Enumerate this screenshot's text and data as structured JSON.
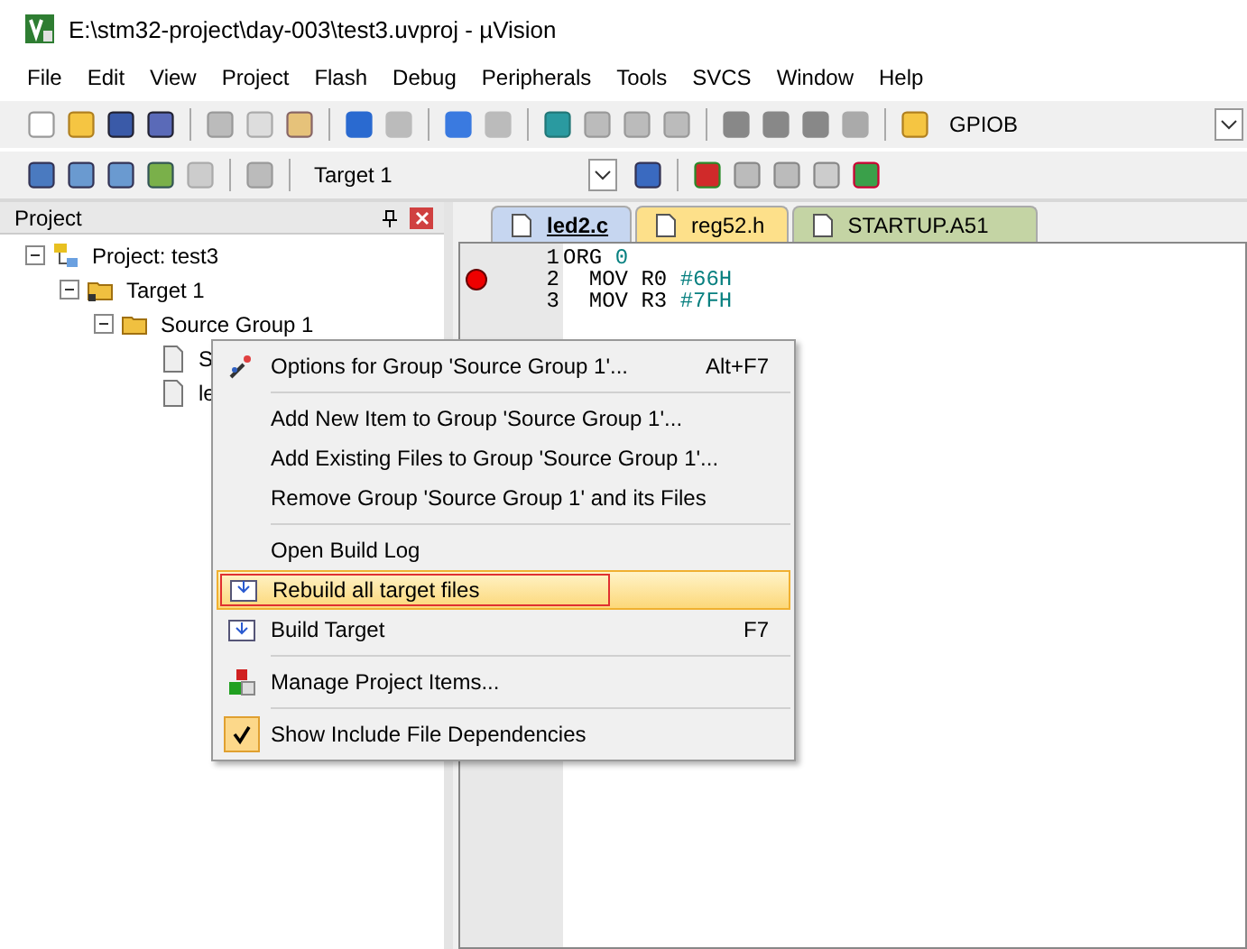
{
  "window": {
    "title": "E:\\stm32-project\\day-003\\test3.uvproj - µVision"
  },
  "menu_bar": [
    "File",
    "Edit",
    "View",
    "Project",
    "Flash",
    "Debug",
    "Peripherals",
    "Tools",
    "SVCS",
    "Window",
    "Help"
  ],
  "toolbar": {
    "function_box": "GPIOB"
  },
  "build_toolbar": {
    "target": "Target 1"
  },
  "project_panel": {
    "title": "Project",
    "tree": [
      {
        "label": "Project: test3",
        "kind": "project",
        "expanded": true,
        "children": [
          {
            "label": "Target 1",
            "kind": "target",
            "expanded": true,
            "children": [
              {
                "label": "Source Group 1",
                "kind": "group",
                "expanded": true,
                "children": [
                  {
                    "label": "S",
                    "kind": "file"
                  },
                  {
                    "label": "le",
                    "kind": "file"
                  }
                ]
              }
            ]
          }
        ]
      }
    ]
  },
  "editor": {
    "tabs": [
      {
        "label": "led2.c",
        "selected": true,
        "color": "#c6d6f0"
      },
      {
        "label": "reg52.h",
        "selected": false,
        "color": "#fde08a"
      },
      {
        "label": "STARTUP.A51",
        "selected": false,
        "color": "#c4d4a4"
      }
    ],
    "lines": [
      {
        "number": "1",
        "code": "ORG ",
        "operand": "0",
        "breakpoint": false
      },
      {
        "number": "2",
        "code": "  MOV R0 ",
        "operand": "#66H",
        "breakpoint": true
      },
      {
        "number": "3",
        "code": "  MOV R3 ",
        "operand": "#7FH",
        "breakpoint": false
      }
    ]
  },
  "context_menu": {
    "groups": [
      [
        {
          "label": "Options for Group 'Source Group 1'...",
          "shortcut": "Alt+F7",
          "selected": false,
          "checked": false
        }
      ],
      [
        {
          "label": "Add New  Item to Group 'Source Group 1'...",
          "selected": false,
          "checked": false
        },
        {
          "label": "Add Existing Files to Group 'Source Group 1'...",
          "selected": false,
          "checked": false
        },
        {
          "label": "Remove Group 'Source Group 1' and its Files",
          "selected": false,
          "checked": false
        }
      ],
      [
        {
          "label": "Open Build Log",
          "selected": false,
          "checked": false
        },
        {
          "label": "Rebuild all target files",
          "selected": true,
          "checked": false
        },
        {
          "label": "Build Target",
          "shortcut": "F7",
          "selected": false,
          "checked": false
        }
      ],
      [
        {
          "label": "Manage Project Items...",
          "selected": false,
          "checked": false
        }
      ],
      [
        {
          "label": "Show Include File Dependencies",
          "selected": false,
          "checked": true
        }
      ]
    ]
  }
}
